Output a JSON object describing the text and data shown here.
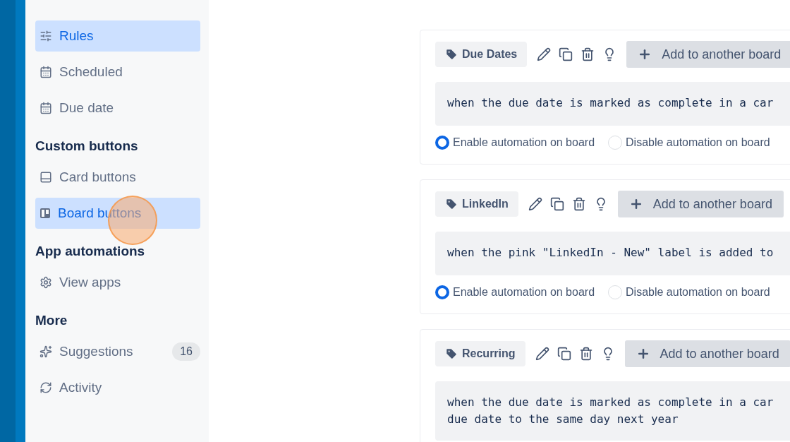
{
  "sidebar": {
    "sections": [
      {
        "items": [
          {
            "label": "Rules",
            "selected": true
          },
          {
            "label": "Scheduled",
            "selected": false
          },
          {
            "label": "Due date",
            "selected": false
          }
        ]
      },
      {
        "title": "Custom buttons",
        "items": [
          {
            "label": "Card buttons",
            "selected": false
          },
          {
            "label": "Board buttons",
            "selected": true
          }
        ]
      },
      {
        "title": "App automations",
        "items": [
          {
            "label": "View apps",
            "selected": false
          }
        ]
      },
      {
        "title": "More",
        "items": [
          {
            "label": "Suggestions",
            "selected": false,
            "badge": "16"
          },
          {
            "label": "Activity",
            "selected": false
          }
        ]
      }
    ]
  },
  "automations": [
    {
      "label": "Due Dates",
      "button": "Add to another board",
      "code": [
        "when the due date is marked as complete in a car"
      ],
      "options": [
        {
          "label": "Enable automation on board",
          "selected": true
        },
        {
          "label": "Disable automation on board",
          "selected": false
        }
      ]
    },
    {
      "label": "LinkedIn",
      "button": "Add to another board",
      "code": [
        "when the pink \"LinkedIn - New\" label is added to"
      ],
      "options": [
        {
          "label": "Enable automation on board",
          "selected": true
        },
        {
          "label": "Disable automation on board",
          "selected": false
        }
      ]
    },
    {
      "label": "Recurring",
      "button": "Add to another board",
      "code": [
        "when the due date is marked as complete in a car",
        "due date to the same day next year"
      ]
    }
  ]
}
